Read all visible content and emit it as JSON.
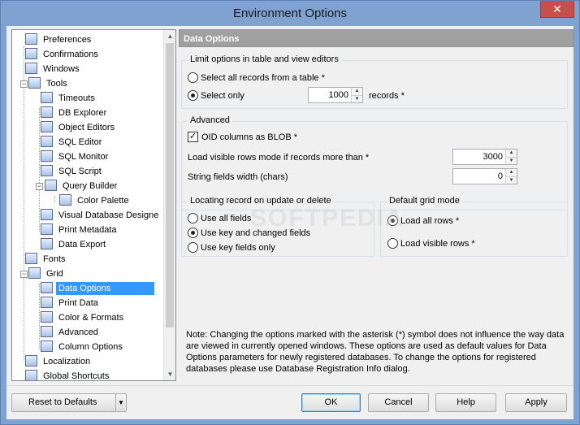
{
  "window": {
    "title": "Environment Options",
    "close_glyph": "✕"
  },
  "tree": {
    "items": [
      {
        "label": "Preferences",
        "icon": "preferences-icon"
      },
      {
        "label": "Confirmations",
        "icon": "confirmations-icon"
      },
      {
        "label": "Windows",
        "icon": "windows-icon"
      },
      {
        "label": "Tools",
        "icon": "tools-icon"
      },
      {
        "label": "Timeouts",
        "icon": "timeouts-icon"
      },
      {
        "label": "DB Explorer",
        "icon": "db-explorer-icon"
      },
      {
        "label": "Object Editors",
        "icon": "object-editors-icon"
      },
      {
        "label": "SQL Editor",
        "icon": "sql-editor-icon"
      },
      {
        "label": "SQL Monitor",
        "icon": "sql-monitor-icon"
      },
      {
        "label": "SQL Script",
        "icon": "sql-script-icon"
      },
      {
        "label": "Query Builder",
        "icon": "query-builder-icon"
      },
      {
        "label": "Color Palette",
        "icon": "color-palette-icon"
      },
      {
        "label": "Visual Database Designe",
        "icon": "visual-designer-icon"
      },
      {
        "label": "Print Metadata",
        "icon": "printer-icon"
      },
      {
        "label": "Data Export",
        "icon": "data-export-icon"
      },
      {
        "label": "Fonts",
        "icon": "fonts-icon"
      },
      {
        "label": "Grid",
        "icon": "grid-icon"
      },
      {
        "label": "Data Options",
        "icon": "data-options-icon"
      },
      {
        "label": "Print Data",
        "icon": "print-data-icon"
      },
      {
        "label": "Color & Formats",
        "icon": "color-formats-icon"
      },
      {
        "label": "Advanced",
        "icon": "advanced-icon"
      },
      {
        "label": "Column Options",
        "icon": "column-options-icon"
      },
      {
        "label": "Localization",
        "icon": "localization-icon"
      },
      {
        "label": "Global Shortcuts",
        "icon": "shortcuts-icon"
      }
    ]
  },
  "panel": {
    "header": "Data Options",
    "limit_group": {
      "title": "Limit options in table and view editors",
      "select_all": "Select all records from a table *",
      "select_only": "Select only",
      "records_value": "1000",
      "records_suffix": "records *"
    },
    "advanced_group": {
      "title": "Advanced",
      "oid_blob": "OID columns as BLOB *",
      "load_visible_label": "Load visible rows mode if records more than *",
      "load_visible_value": "3000",
      "string_width_label": "String fields width (chars)",
      "string_width_value": "0"
    },
    "locating_group": {
      "title": "Locating record on update or delete",
      "use_all": "Use all fields",
      "use_key_changed": "Use key and changed fields",
      "use_key_only": "Use key fields only"
    },
    "grid_mode_group": {
      "title": "Default grid mode",
      "load_all": "Load all rows *",
      "load_visible": "Load visible rows *"
    },
    "note": "Note: Changing the options marked with the asterisk (*) symbol does not influence the way data are viewed in currently opened windows. These options are used as default values for Data Options parameters for newly registered databases. To change the options for registered databases please use Database Registration Info dialog."
  },
  "buttons": {
    "reset": "Reset to Defaults",
    "ok": "OK",
    "cancel": "Cancel",
    "help": "Help",
    "apply": "Apply"
  },
  "watermark": "SOFTPEDIA"
}
